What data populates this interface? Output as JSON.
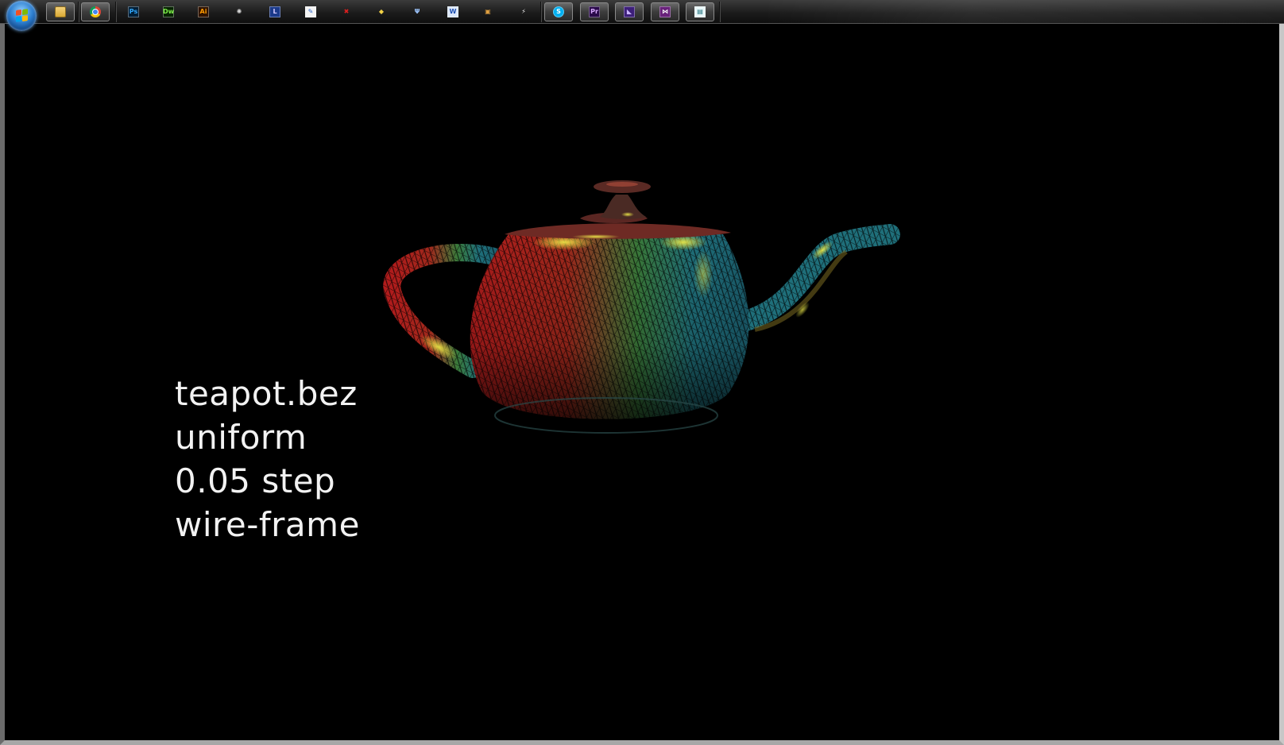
{
  "taskbar": {
    "start_button": "start-orb",
    "pinned_apps": [
      {
        "name": "windows-explorer",
        "icon": "folder-icon",
        "active": true,
        "glyph": "",
        "fg": "#e8c86b",
        "bg": "#5d7fa8"
      },
      {
        "name": "google-chrome",
        "icon": "chrome-icon",
        "active": true,
        "glyph": "",
        "fg": "#ffffff",
        "bg": "#ffffff"
      },
      {
        "name": "photoshop",
        "icon": "photoshop-icon",
        "active": false,
        "glyph": "Ps",
        "fg": "#31a8ff",
        "bg": "#001e36"
      },
      {
        "name": "dreamweaver",
        "icon": "dreamweaver-icon",
        "active": false,
        "glyph": "Dw",
        "fg": "#7ef04a",
        "bg": "#072401"
      },
      {
        "name": "illustrator",
        "icon": "illustrator-icon",
        "active": false,
        "glyph": "Ai",
        "fg": "#ff9a00",
        "bg": "#2f1300"
      },
      {
        "name": "settings-tool",
        "icon": "gear-icon",
        "active": false,
        "glyph": "✺",
        "fg": "#d8d8d8",
        "bg": "transparent"
      },
      {
        "name": "lightroom",
        "icon": "lightroom-icon",
        "active": false,
        "glyph": "L",
        "fg": "#d6c9ff",
        "bg": "#1b3a8a"
      },
      {
        "name": "paint",
        "icon": "paint-icon",
        "active": false,
        "glyph": "✎",
        "fg": "#2b62c6",
        "bg": "#f4f4f4"
      },
      {
        "name": "red-tool",
        "icon": "tools-icon",
        "active": false,
        "glyph": "✖",
        "fg": "#e02020",
        "bg": "transparent"
      },
      {
        "name": "photo-viewer",
        "icon": "gallery-icon",
        "active": false,
        "glyph": "◆",
        "fg": "#f2d246",
        "bg": "transparent"
      },
      {
        "name": "network-tool",
        "icon": "network-icon",
        "active": false,
        "glyph": "Ψ",
        "fg": "#9ec6ff",
        "bg": "transparent"
      },
      {
        "name": "word",
        "icon": "word-icon",
        "active": false,
        "glyph": "W",
        "fg": "#1d4fb0",
        "bg": "#dbe7fb"
      },
      {
        "name": "media-tool",
        "icon": "slideshow-icon",
        "active": false,
        "glyph": "▣",
        "fg": "#e0a040",
        "bg": "transparent"
      },
      {
        "name": "connect-tool",
        "icon": "plug-icon",
        "active": false,
        "glyph": "⚡",
        "fg": "#e8e8e8",
        "bg": "transparent"
      },
      {
        "name": "skype",
        "icon": "skype-icon",
        "active": true,
        "glyph": "S",
        "fg": "#ffffff",
        "bg": "#00aff0"
      },
      {
        "name": "premiere",
        "icon": "premiere-icon",
        "active": true,
        "glyph": "Pr",
        "fg": "#d7a9ff",
        "bg": "#2a0a4a"
      },
      {
        "name": "visual-studio-alt",
        "icon": "visual-studio-icon",
        "active": true,
        "glyph": "◣",
        "fg": "#c9b3ff",
        "bg": "#3d1f7a"
      },
      {
        "name": "visual-studio",
        "icon": "visual-studio-icon",
        "active": true,
        "glyph": "⋈",
        "fg": "#ffffff",
        "bg": "#68217a"
      },
      {
        "name": "opengl-window",
        "icon": "app-window-icon",
        "active": true,
        "glyph": "▤",
        "fg": "#1a6e7a",
        "bg": "#e8f6f8"
      }
    ]
  },
  "overlay_text": {
    "line1": "teapot.bez",
    "line2": "uniform",
    "line3": "0.05 step",
    "line4": "wire-frame"
  },
  "colors": {
    "background": "#000000",
    "text": "#f2f2f2",
    "wire_red": "#b01c1c",
    "wire_green": "#2e8a4e",
    "wire_teal": "#1f6f7a",
    "highlight": "#e8e64a"
  }
}
